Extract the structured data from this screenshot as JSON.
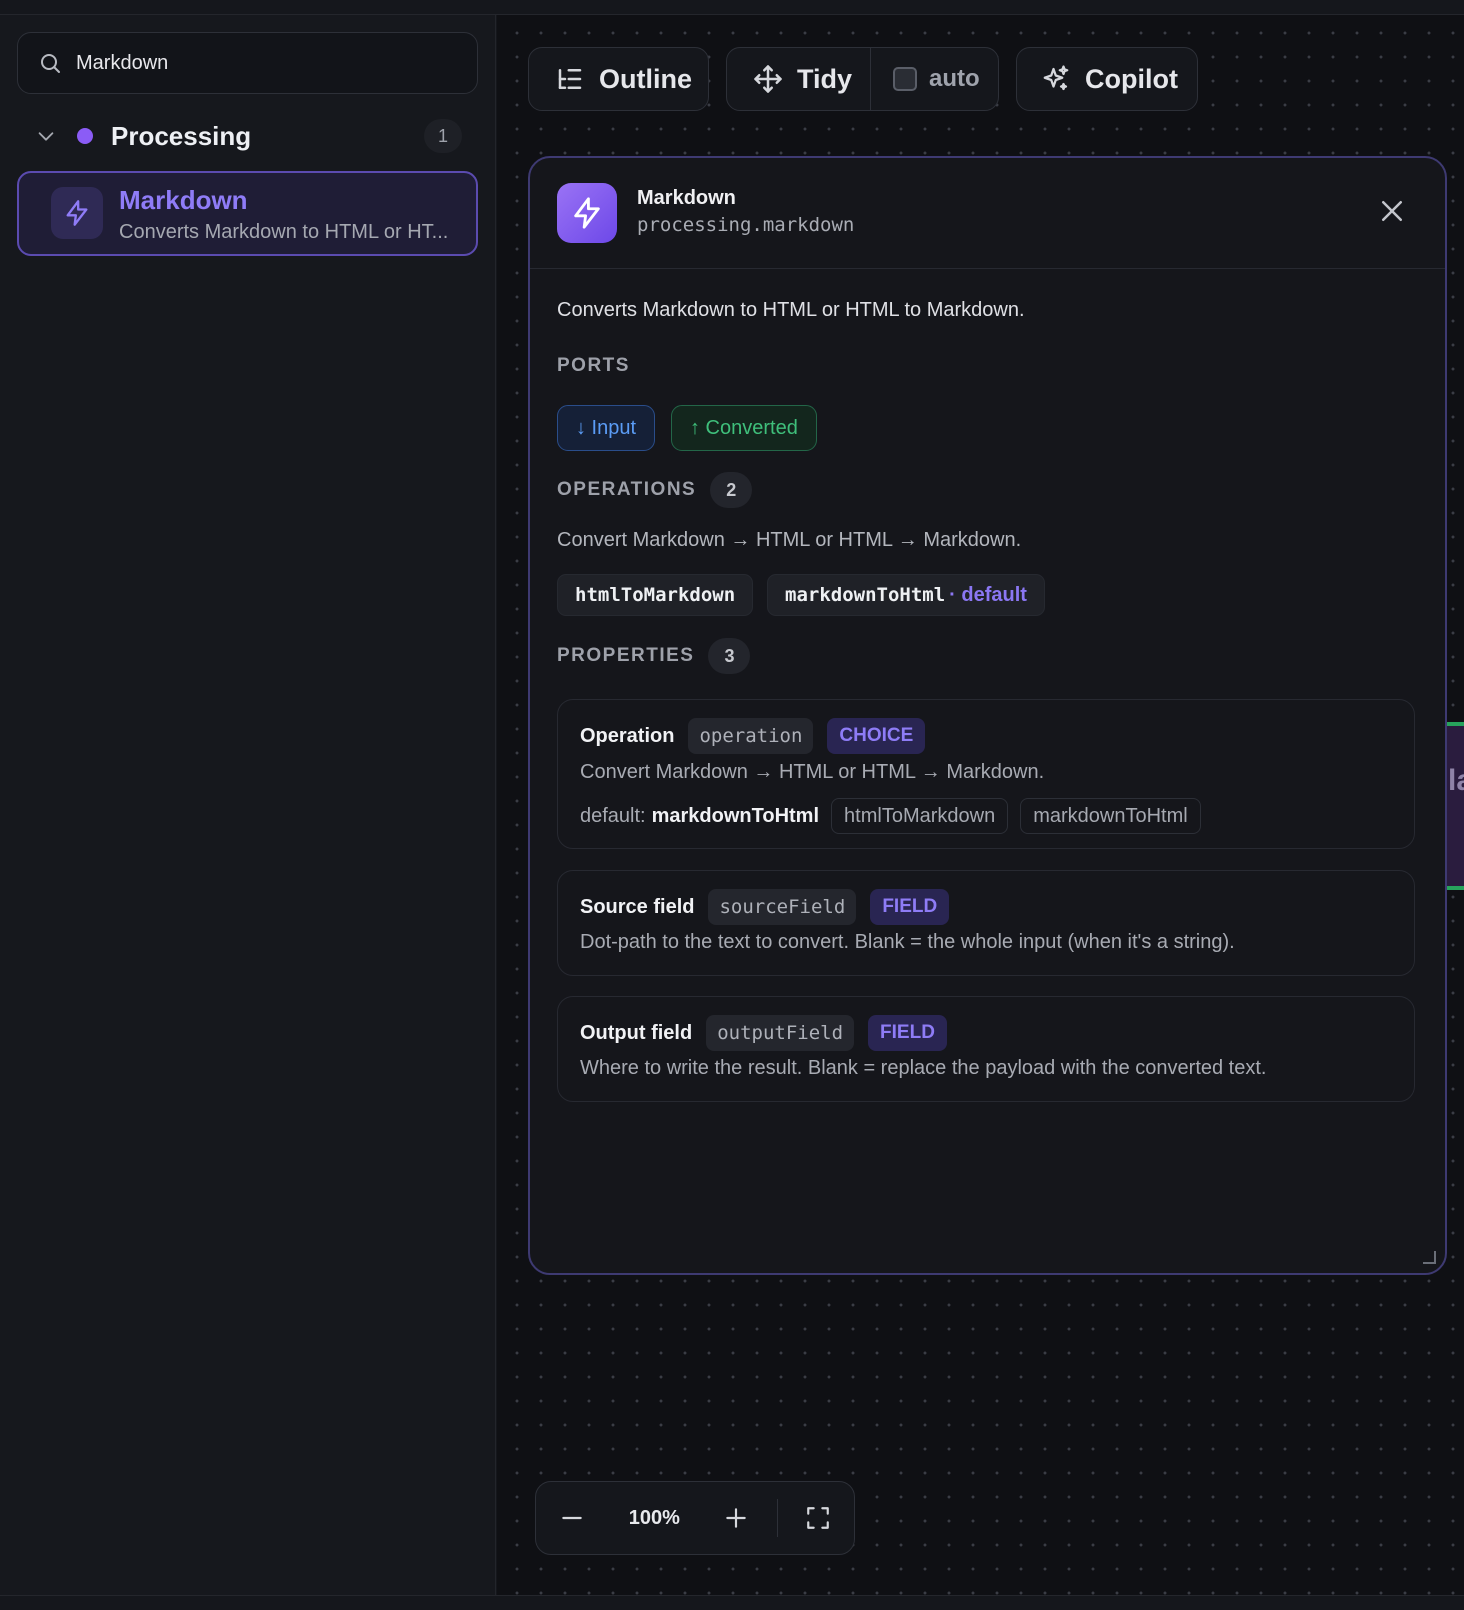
{
  "sidebar": {
    "search": {
      "value": "Markdown"
    },
    "group": {
      "title": "Processing",
      "count": "1",
      "dot_color": "#8b5cf6"
    },
    "item": {
      "name": "Markdown",
      "description": "Converts Markdown to HTML or HT..."
    }
  },
  "toolbar": {
    "outline_label": "Outline",
    "tidy_label": "Tidy",
    "auto_label": "auto",
    "copilot_label": "Copilot"
  },
  "panel": {
    "title": "Markdown",
    "id": "processing.markdown",
    "description": "Converts Markdown to HTML or HTML to Markdown.",
    "ports": {
      "heading": "PORTS",
      "input": "↓ Input",
      "output": "↑ Converted"
    },
    "operations": {
      "heading": "OPERATIONS",
      "count": "2",
      "description": "Convert Markdown → HTML or HTML → Markdown.",
      "items": [
        {
          "name": "htmlToMarkdown",
          "suffix": ""
        },
        {
          "name": "markdownToHtml",
          "suffix": "· default"
        }
      ]
    },
    "properties": {
      "heading": "PROPERTIES",
      "count": "3",
      "items": [
        {
          "name": "Operation",
          "key": "operation",
          "type": "CHOICE",
          "description": "Convert Markdown → HTML or HTML → Markdown.",
          "default_label": "default:",
          "default_value": "markdownToHtml",
          "options": [
            "htmlToMarkdown",
            "markdownToHtml"
          ]
        },
        {
          "name": "Source field",
          "key": "sourceField",
          "type": "FIELD",
          "description": "Dot-path to the text to convert. Blank = the whole input (when it's a string)."
        },
        {
          "name": "Output field",
          "key": "outputField",
          "type": "FIELD",
          "description": "Where to write the result. Blank = replace the payload with the converted text."
        }
      ]
    }
  },
  "canvas": {
    "edge_node_text": "la"
  },
  "zoom": {
    "level": "100%"
  },
  "colors": {
    "accent": "#8b5cf6",
    "input_port": "#5b9cf5",
    "output_port": "#3fbf7b"
  }
}
